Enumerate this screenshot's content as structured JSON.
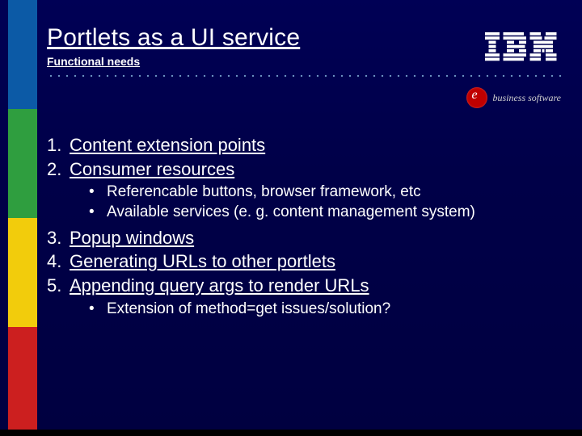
{
  "header": {
    "title": "Portlets as a UI service",
    "subtitle": "Functional needs",
    "logo_name": "IBM",
    "ebiz_label": "business software"
  },
  "items": [
    {
      "n": "1.",
      "text": "Content extension points",
      "subs": []
    },
    {
      "n": "2.",
      "text": "Consumer resources",
      "subs": [
        "Referencable buttons, browser framework, etc",
        "Available services (e. g. content management system)"
      ]
    },
    {
      "n": "3.",
      "text": "Popup windows",
      "subs": []
    },
    {
      "n": "4.",
      "text": "Generating URLs to other portlets",
      "subs": []
    },
    {
      "n": "5.",
      "text": "Appending query args to render URLs",
      "subs": [
        "Extension of method=get issues/solution?"
      ]
    }
  ],
  "colors": {
    "background": "#000048",
    "accent_blue": "#0c5aa6",
    "accent_green": "#2f9e3f",
    "accent_yellow": "#f2cc0c",
    "accent_red": "#cc1f1f"
  }
}
